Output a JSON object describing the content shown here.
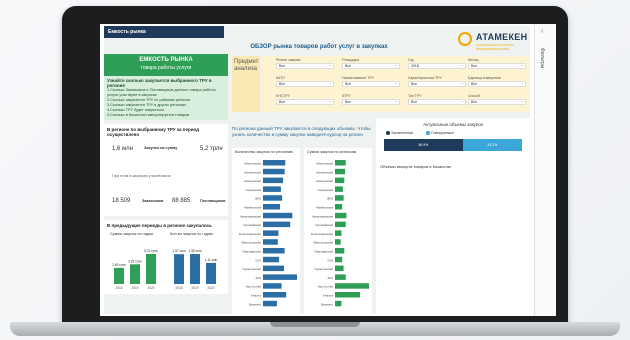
{
  "report": {
    "tab_title": "Емкость рынка",
    "main_title": "ОБЗОР рынка товаров работ услуг в закупках",
    "logo_name": "АТАМЕКЕН",
    "logo_sub": "НАЦИОНАЛЬНАЯ ПАЛАТА ПРЕДПРИНИМАТЕЛЕЙ"
  },
  "side_panel": {
    "collapse_glyph": "‹",
    "label": "Фильтры"
  },
  "market": {
    "title": "ЕМКОСТЬ РЫНКА",
    "subtitle": "товара работы услуги",
    "question": "Узнайте сколько закупается выбранного ТРУ в регионе",
    "answers": [
      "1.Сколько Заказчиков и Поставщиков данного товара работы услуги участвуют в закупках",
      "2.Сколько закупается ТРУ по районам региона.",
      "3.Сколько закупается ТРУ в других регионах.",
      "4.Сколько ТРУ будет закупаться",
      "5.Сколько в Казахстан импортируется товаров"
    ]
  },
  "kpi": {
    "title": "В регионе по выбранному ТРУ за период осуществлено",
    "count_value": "1,6 млн",
    "sum_label": "Закупок на сумму",
    "sum_value": "5,2 трлн",
    "participants_label": "При этом в закупках участвовали",
    "customers_value": "18 509",
    "customers_label": "Заказчиков",
    "suppliers_value": "88 885",
    "suppliers_label": "Поставщиков"
  },
  "prev": {
    "title": "В предыдущие периоды в регионе закупалось",
    "sum_label": "Сумма закупок по годам",
    "count_label": "Кол-во закупок по годам"
  },
  "subject": {
    "label": "Предмет анализа"
  },
  "filters": [
    {
      "label": "Регион закупки",
      "value": "Все"
    },
    {
      "label": "Площадка",
      "value": "Все"
    },
    {
      "label": "Год",
      "value": "2018"
    },
    {
      "label": "Месяц",
      "value": "Все"
    },
    {
      "label": "КАТО",
      "value": "Все"
    },
    {
      "label": "Наименование ТРУ",
      "value": "Все"
    },
    {
      "label": "Характеристика ТРУ",
      "value": "Все"
    },
    {
      "label": "Единица измерения",
      "value": "Все"
    },
    {
      "label": "ЕНСТРУ",
      "value": "Все"
    },
    {
      "label": "КТРУ",
      "value": "Все"
    },
    {
      "label": "Тип ТРУ",
      "value": "Все"
    },
    {
      "label": "Способ",
      "value": "Все"
    }
  ],
  "note": "По региона данный ТРУ закупается в следующих объемах. Чтобы узнать количество и сумму закупок наведите курсор на регион",
  "actual": {
    "title": "Актуальные объемы закупок",
    "legend": [
      "Заключенные",
      "Планируемые"
    ],
    "import_title": "Объемы импорта товаров в Казахстан",
    "segments": [
      "56,9%",
      "43,1%"
    ]
  },
  "colors": {
    "primary": "#1f5e8c",
    "bar": "#2b6ea6",
    "green": "#2f9f57",
    "light_green": "#d8efdd",
    "yellow": "#fbe9b4"
  },
  "chart_data": [
    {
      "type": "bar",
      "title": "Сумма закупок по годам",
      "categories": [
        "2018",
        "2019",
        "2020"
      ],
      "values": [
        2.69,
        3.29,
        5.01
      ],
      "value_labels": [
        "2,69 трлн",
        "3,29 трлн",
        "5,01 трлн"
      ]
    },
    {
      "type": "bar",
      "title": "Кол-во закупок по годам",
      "categories": [
        "2018",
        "2019",
        "2020"
      ],
      "values": [
        1.57,
        1.58,
        1.11
      ],
      "value_labels": [
        "1,57 млн",
        "1,58 млн",
        "1,11 млн"
      ]
    },
    {
      "type": "bar",
      "orientation": "horizontal",
      "title": "Количество закупок по регионам",
      "categories": [
        "Акмолинская",
        "Актюбинская",
        "Алматинская",
        "Атырауская",
        "ВКО",
        "Жамбылская",
        "Карагандинская",
        "Костанайская",
        "Кызылординская",
        "Мангистауская",
        "Павлодарская",
        "СКО",
        "Туркестанская",
        "ЗКО",
        "Нур-Султан",
        "Алматы",
        "Шымкент"
      ],
      "values": [
        72,
        70,
        65,
        58,
        62,
        55,
        95,
        88,
        50,
        48,
        70,
        52,
        68,
        110,
        60,
        75,
        45
      ]
    },
    {
      "type": "bar",
      "orientation": "horizontal",
      "title": "Сумма закупок по регионам",
      "categories": [
        "Акмолинская",
        "Актюбинская",
        "Алматинская",
        "Атырауская",
        "ВКО",
        "Жамбылская",
        "Карагандинская",
        "Костанайская",
        "Кызылординская",
        "Мангистауская",
        "Павлодарская",
        "СКО",
        "Туркестанская",
        "ЗКО",
        "Нур-Султан",
        "Алматы",
        "Шымкент"
      ],
      "values": [
        30,
        28,
        26,
        22,
        24,
        20,
        32,
        30,
        18,
        16,
        26,
        20,
        24,
        30,
        95,
        70,
        18
      ]
    }
  ]
}
